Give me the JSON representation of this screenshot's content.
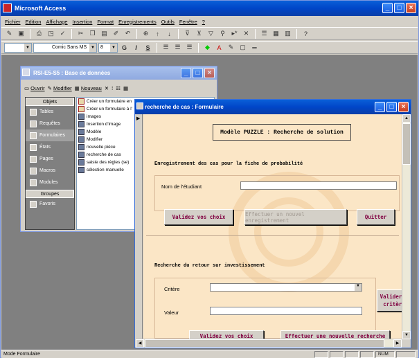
{
  "app": {
    "title": "Microsoft Access"
  },
  "menu": [
    "Fichier",
    "Edition",
    "Affichage",
    "Insertion",
    "Format",
    "Enregistrements",
    "Outils",
    "Fenêtre",
    "?"
  ],
  "toolbar2": {
    "font_name": "Comic Sans MS",
    "font_size": "8",
    "bold": "G",
    "italic": "I",
    "underline": "S"
  },
  "db_window": {
    "title": "RSI-E5-S5 : Base de données",
    "toolbar": {
      "open": "Ouvrir",
      "modify": "Modifier",
      "new": "Nouveau"
    },
    "objects_header": "Objets",
    "objects": [
      "Tables",
      "Requêtes",
      "Formulaires",
      "États",
      "Pages",
      "Macros",
      "Modules"
    ],
    "groups_header": "Groupes",
    "groups": [
      "Favoris"
    ],
    "items": [
      "Créer un formulaire en",
      "Créer un formulaire à l'",
      "images",
      "Insertion d'image",
      "Modèle",
      "Modifier",
      "nouvelle pièce",
      "recherche de cas",
      "saisie des règles (se)",
      "sélection manuelle"
    ]
  },
  "form_window": {
    "title": "recherche de cas : Formulaire",
    "heading": "Modèle PUZZLE : Recherche de solution",
    "section1": "Enregistrement des cas pour la fiche de probabilité",
    "student_label": "Nom de l'étudiant",
    "student_value": "",
    "btn_validate": "Validez vos choix",
    "btn_new_record": "Effectuer un nouvel enregistrement",
    "btn_quit": "Quitter",
    "section2": "Recherche du retour sur investissement",
    "criteria_label": "Critère",
    "criteria_value": "",
    "value_label": "Valeur",
    "value_value": "",
    "btn_validate_criteria": "Valider c critère",
    "btn_validate2": "Validez vos choix",
    "btn_new_search": "Effectuer une nouvelle recherche"
  },
  "status": {
    "mode": "Mode Formulaire",
    "num": "NUM"
  }
}
